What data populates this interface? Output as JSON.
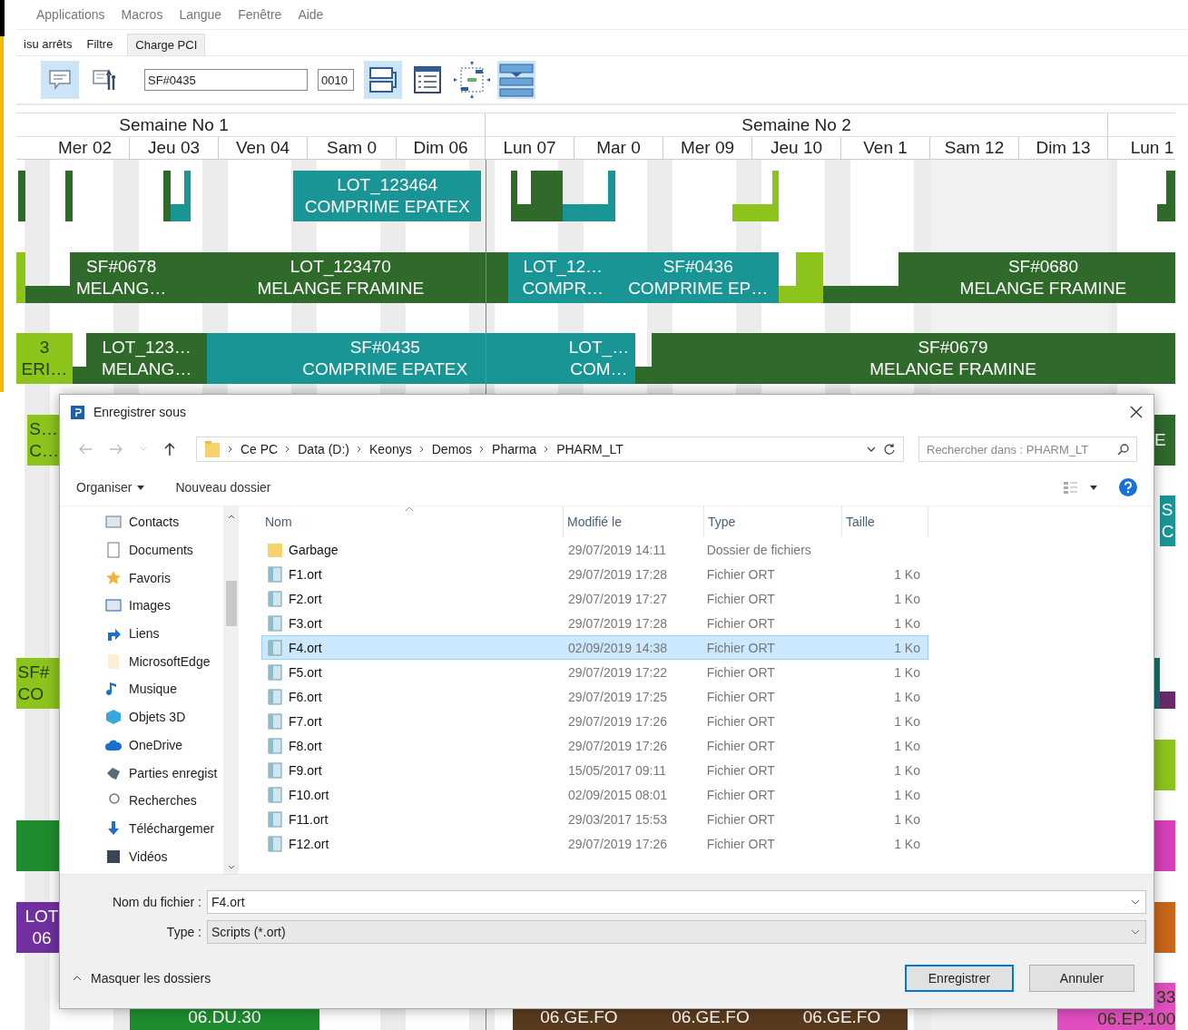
{
  "menu": [
    {
      "label": "Applications"
    },
    {
      "label": "Macros"
    },
    {
      "label": "Langue"
    },
    {
      "label": "Fenêtre"
    },
    {
      "label": "Aide"
    }
  ],
  "tabs": [
    {
      "label": "isu arrêts",
      "selected": false
    },
    {
      "label": "Filtre",
      "selected": false
    },
    {
      "label": "Charge PCI",
      "selected": true
    }
  ],
  "toolbar": {
    "left_buttons": [
      {
        "pressed": true
      },
      {
        "pressed": false
      }
    ],
    "lot_field": {
      "value": "SF#0435"
    },
    "qty_field": {
      "value": "0010"
    },
    "right_buttons": [
      {
        "pressed": true
      },
      {
        "pressed": false
      },
      {
        "pressed": false
      },
      {
        "pressed": true
      }
    ]
  },
  "gantt": {
    "weeks": [
      {
        "label": "Semaine No 1"
      },
      {
        "label": "Semaine No 2"
      }
    ],
    "days": [
      {
        "label": "Mer 02"
      },
      {
        "label": "Jeu 03"
      },
      {
        "label": "Ven 04"
      },
      {
        "label": "Sam 0"
      },
      {
        "label": "Dim 06"
      },
      {
        "label": "Lun 07"
      },
      {
        "label": "Mar 0"
      },
      {
        "label": "Mer 09"
      },
      {
        "label": "Jeu 10"
      },
      {
        "label": "Ven 1"
      },
      {
        "label": "Sam 12"
      },
      {
        "label": "Dim 13"
      },
      {
        "label": "Lun 1"
      }
    ],
    "rows": [
      {
        "bars": [
          {
            "color": "#2f6a2b"
          },
          {
            "color": "#2f6a2b"
          },
          {
            "color": "#2f6a2b"
          },
          {
            "color": "#1a9596"
          },
          {
            "color": "#1a9596"
          },
          {
            "color": "#1a9596",
            "lines": [
              "LOT_123464",
              "COMPRIME EPATEX"
            ]
          },
          {
            "color": "#2f6a2b"
          },
          {
            "color": "#2f6a2b"
          },
          {
            "color": "#2f6a2b"
          },
          {
            "color": "#1a9596"
          },
          {
            "color": "#1a9596"
          },
          {
            "color": "#8dc41c"
          },
          {
            "color": "#8dc41c"
          },
          {
            "color": "#2f6a2b"
          },
          {
            "color": "#2f6a2b"
          }
        ]
      },
      {
        "bars": [
          {
            "color": "#8dc41c"
          },
          {
            "color": "#2f6a2b"
          },
          {
            "color": "#2f6a2b",
            "lines": [
              "SF#0678",
              "MELANG…"
            ]
          },
          {
            "color": "#2f6a2b",
            "lines": [
              "LOT_123470",
              "MELANGE FRAMINE"
            ]
          },
          {
            "color": "#1a9596",
            "lines": [
              "LOT_12…",
              "COMPR…"
            ]
          },
          {
            "color": "#1a9596",
            "lines": [
              "SF#0436",
              "COMPRIME EP…"
            ]
          },
          {
            "color": "#8dc41c"
          },
          {
            "color": "#8dc41c"
          },
          {
            "color": "#2f6a2b"
          },
          {
            "color": "#2f6a2b",
            "lines": [
              "SF#0680",
              "MELANGE FRAMINE"
            ]
          }
        ]
      },
      {
        "bars": [
          {
            "color": "#8dc41c",
            "lines": [
              "3",
              "ERI…"
            ]
          },
          {
            "color": "#2f6a2b"
          },
          {
            "color": "#2f6a2b",
            "lines": [
              "LOT_123…",
              "MELANG…"
            ]
          },
          {
            "color": "#1a9596",
            "lines": [
              "SF#0435",
              "COMPRIME EPATEX"
            ]
          },
          {
            "color": "#1a9596",
            "lines": [
              "LOT_…",
              "COM…"
            ]
          },
          {
            "color": "#2f6a2b"
          },
          {
            "color": "#2f6a2b",
            "lines": [
              "SF#0679",
              "MELANGE FRAMINE"
            ]
          }
        ]
      },
      {
        "bars": [
          {
            "color": "#8dc41c",
            "lines": [
              "S…",
              "C…"
            ]
          },
          {
            "color": "#2f6a2b",
            "lines": [
              "E"
            ]
          }
        ]
      },
      {
        "bars": [
          {
            "color": "#1a9596",
            "lines": [
              "S",
              "C"
            ]
          }
        ]
      },
      {
        "bars": [
          {
            "color": "#8dc41c",
            "lines": [
              "SF#",
              "CO"
            ]
          },
          {
            "color": "#17706e"
          },
          {
            "color": "#6a2a6a"
          }
        ]
      },
      {
        "bars": [
          {
            "color": "#8dc41c"
          }
        ]
      },
      {
        "bars": [
          {
            "color": "#1f8c2f"
          },
          {
            "color": "#d63fb8"
          }
        ]
      },
      {
        "bars": [
          {
            "color": "#7030a0",
            "lines": [
              "LOT",
              "06"
            ]
          },
          {
            "color": "#c8661a"
          }
        ]
      },
      {
        "bars": [
          {
            "color": "#1f8c2f",
            "lines": [
              "06.DU.30"
            ]
          },
          {
            "color": "#5a3a1e",
            "lines": [
              "06.GE.FO"
            ]
          },
          {
            "color": "#5a3a1e",
            "lines": [
              "06.GE.FO"
            ]
          },
          {
            "color": "#5a3a1e",
            "lines": [
              "06.GE.FO"
            ]
          },
          {
            "color": "#e04ec0",
            "lines": [
              "33",
              "06.EP.100"
            ]
          }
        ]
      }
    ]
  },
  "dialog": {
    "title": "Enregistrer sous",
    "path": [
      "Ce PC",
      "Data (D:)",
      "Keonys",
      "Demos",
      "Pharma",
      "PHARM_LT"
    ],
    "search": {
      "placeholder": "Rechercher dans : PHARM_LT"
    },
    "commands": [
      {
        "label": "Organiser",
        "menu": true
      },
      {
        "label": "Nouveau dossier",
        "menu": false
      }
    ],
    "nav": [
      {
        "label": "Contacts"
      },
      {
        "label": "Documents"
      },
      {
        "label": "Favoris"
      },
      {
        "label": "Images"
      },
      {
        "label": "Liens"
      },
      {
        "label": "MicrosoftEdge"
      },
      {
        "label": "Musique"
      },
      {
        "label": "Objets 3D"
      },
      {
        "label": "OneDrive"
      },
      {
        "label": "Parties enregist"
      },
      {
        "label": "Recherches"
      },
      {
        "label": "Téléchargemer"
      },
      {
        "label": "Vidéos"
      }
    ],
    "columns": [
      "Nom",
      "Modifié le",
      "Type",
      "Taille"
    ],
    "files": [
      {
        "kind": "folder",
        "name": "Garbage",
        "modified": "29/07/2019 14:11",
        "type": "Dossier de fichiers",
        "selected": false
      },
      {
        "kind": "file",
        "name": "F1.ort",
        "modified": "29/07/2019 17:28",
        "type": "Fichier ORT",
        "size": "1 Ko",
        "selected": false
      },
      {
        "kind": "file",
        "name": "F2.ort",
        "modified": "29/07/2019 17:27",
        "type": "Fichier ORT",
        "size": "1 Ko",
        "selected": false
      },
      {
        "kind": "file",
        "name": "F3.ort",
        "modified": "29/07/2019 17:28",
        "type": "Fichier ORT",
        "size": "1 Ko",
        "selected": false
      },
      {
        "kind": "file",
        "name": "F4.ort",
        "modified": "02/09/2019 14:38",
        "type": "Fichier ORT",
        "size": "1 Ko",
        "selected": true
      },
      {
        "kind": "file",
        "name": "F5.ort",
        "modified": "29/07/2019 17:22",
        "type": "Fichier ORT",
        "size": "1 Ko",
        "selected": false
      },
      {
        "kind": "file",
        "name": "F6.ort",
        "modified": "29/07/2019 17:25",
        "type": "Fichier ORT",
        "size": "1 Ko",
        "selected": false
      },
      {
        "kind": "file",
        "name": "F7.ort",
        "modified": "29/07/2019 17:26",
        "type": "Fichier ORT",
        "size": "1 Ko",
        "selected": false
      },
      {
        "kind": "file",
        "name": "F8.ort",
        "modified": "29/07/2019 17:26",
        "type": "Fichier ORT",
        "size": "1 Ko",
        "selected": false
      },
      {
        "kind": "file",
        "name": "F9.ort",
        "modified": "15/05/2017 09:11",
        "type": "Fichier ORT",
        "size": "1 Ko",
        "selected": false
      },
      {
        "kind": "file",
        "name": "F10.ort",
        "modified": "02/09/2015 08:01",
        "type": "Fichier ORT",
        "size": "1 Ko",
        "selected": false
      },
      {
        "kind": "file",
        "name": "F11.ort",
        "modified": "29/03/2017 15:53",
        "type": "Fichier ORT",
        "size": "1 Ko",
        "selected": false
      },
      {
        "kind": "file",
        "name": "F12.ort",
        "modified": "29/07/2019 17:26",
        "type": "Fichier ORT",
        "size": "1 Ko",
        "selected": false
      }
    ],
    "filename": {
      "label": "Nom du fichier :",
      "value": "F4.ort"
    },
    "filetype": {
      "label": "Type :",
      "value": "Scripts (*.ort)"
    },
    "toggle": "Masquer les dossiers",
    "buttons": [
      {
        "label": "Enregistrer",
        "default": true
      },
      {
        "label": "Annuler",
        "default": false
      }
    ]
  }
}
